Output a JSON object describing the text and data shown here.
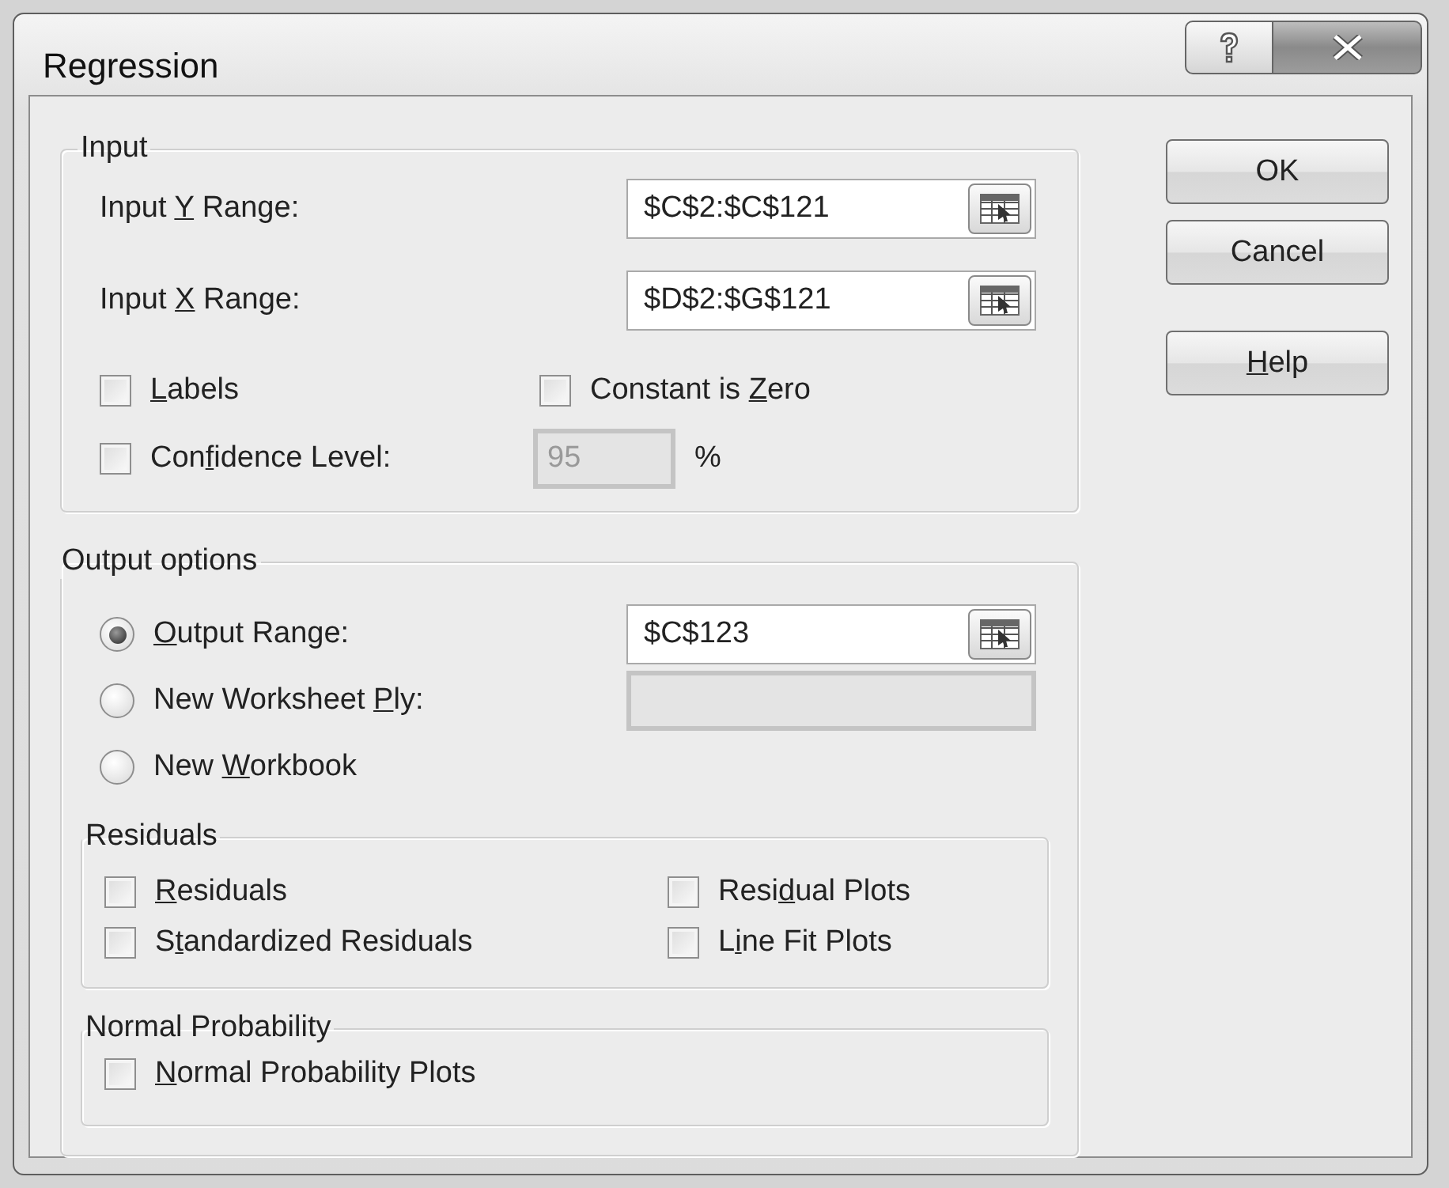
{
  "window": {
    "title": "Regression"
  },
  "input": {
    "legend": "Input",
    "ranges": [
      {
        "label": {
          "pre": "Input ",
          "key": "Y",
          "post": " Range:"
        },
        "value": "$C$2:$C$121"
      },
      {
        "label": {
          "pre": "Input ",
          "key": "X",
          "post": " Range:"
        },
        "value": "$D$2:$G$121"
      }
    ],
    "options": [
      {
        "label": {
          "key": "L",
          "post": "abels"
        },
        "checked": false
      },
      {
        "label": {
          "pre": "Constant is ",
          "key": "Z",
          "post": "ero"
        },
        "checked": false
      },
      {
        "label": {
          "pre": "Con",
          "key": "f",
          "post": "idence Level:"
        },
        "checked": false
      }
    ],
    "confidence": {
      "value": "95",
      "disabled": true,
      "unit": "%"
    }
  },
  "output": {
    "legend": "Output options",
    "destinations": [
      {
        "label": {
          "key": "O",
          "post": "utput Range:"
        },
        "selected": true,
        "field": {
          "value": "$C$123",
          "disabled": false
        }
      },
      {
        "label": {
          "pre": "New Worksheet ",
          "key": "P",
          "post": "ly:"
        },
        "selected": false,
        "field": {
          "disabled": true
        }
      },
      {
        "label": {
          "pre": "New ",
          "key": "W",
          "post": "orkbook"
        },
        "selected": false
      }
    ],
    "residuals": {
      "legend": "Residuals",
      "options": [
        {
          "label": {
            "key": "R",
            "post": "esiduals"
          },
          "checked": false
        },
        {
          "label": {
            "pre": "Resi",
            "key": "d",
            "post": "ual Plots"
          },
          "checked": false
        },
        {
          "label": {
            "pre": "S",
            "key": "t",
            "post": "andardized Residuals"
          },
          "checked": false
        },
        {
          "label": {
            "pre": "L",
            "key": "i",
            "post": "ne Fit Plots"
          },
          "checked": false
        }
      ]
    },
    "normal_probability": {
      "legend": "Normal Probability",
      "options": [
        {
          "label": {
            "key": "N",
            "post": "ormal Probability Plots"
          },
          "checked": false
        }
      ]
    }
  },
  "buttons": [
    {
      "label": {
        "pre": "OK"
      }
    },
    {
      "label": {
        "pre": "Cancel"
      }
    },
    {
      "label": {
        "key": "H",
        "post": "elp"
      }
    }
  ]
}
